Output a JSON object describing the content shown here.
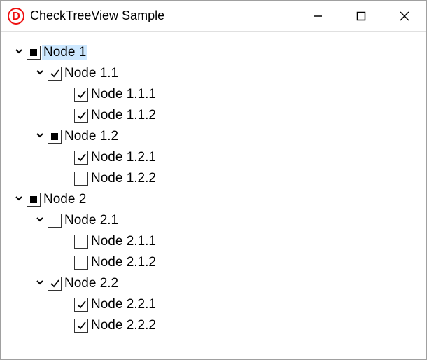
{
  "window": {
    "title": "CheckTreeView Sample",
    "app_icon_letter": "D"
  },
  "tree": {
    "nodes": [
      {
        "label": "Node 1",
        "check": "indeterminate",
        "expanded": true,
        "selected": true,
        "children": [
          {
            "label": "Node 1.1",
            "check": "checked",
            "expanded": true,
            "children": [
              {
                "label": "Node 1.1.1",
                "check": "checked"
              },
              {
                "label": "Node 1.1.2",
                "check": "checked"
              }
            ]
          },
          {
            "label": "Node 1.2",
            "check": "indeterminate",
            "expanded": true,
            "children": [
              {
                "label": "Node 1.2.1",
                "check": "checked"
              },
              {
                "label": "Node 1.2.2",
                "check": "unchecked"
              }
            ]
          }
        ]
      },
      {
        "label": "Node 2",
        "check": "indeterminate",
        "expanded": true,
        "children": [
          {
            "label": "Node 2.1",
            "check": "unchecked",
            "expanded": true,
            "children": [
              {
                "label": "Node 2.1.1",
                "check": "unchecked"
              },
              {
                "label": "Node 2.1.2",
                "check": "unchecked"
              }
            ]
          },
          {
            "label": "Node 2.2",
            "check": "checked",
            "expanded": true,
            "children": [
              {
                "label": "Node 2.2.1",
                "check": "checked"
              },
              {
                "label": "Node 2.2.2",
                "check": "checked"
              }
            ]
          }
        ]
      }
    ]
  }
}
